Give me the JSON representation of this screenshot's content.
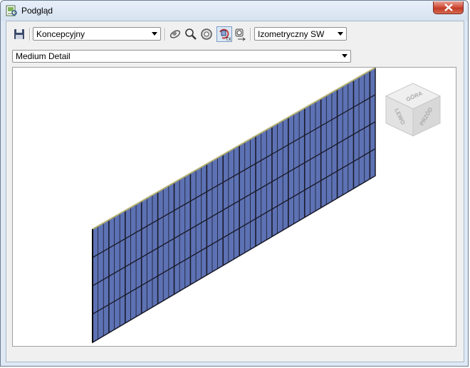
{
  "window": {
    "title": "Podgląd"
  },
  "toolbar": {
    "visual_style": "Koncepcyjny",
    "view": "Izometryczny SW"
  },
  "detail_level": {
    "value": "Medium Detail"
  },
  "viewcube": {
    "top": "GÓRA",
    "left": "LEWO",
    "front": "PRZÓD"
  },
  "colors": {
    "panel_fill": "#5d72b4",
    "panel_edge": "#1a1a2a",
    "background": "#ffffff",
    "chrome": "#dfe9f5"
  },
  "icons": [
    "save-icon",
    "orbit-icon",
    "zoom-icon",
    "steering-wheel-icon",
    "isolate-icon",
    "camera-icon"
  ]
}
